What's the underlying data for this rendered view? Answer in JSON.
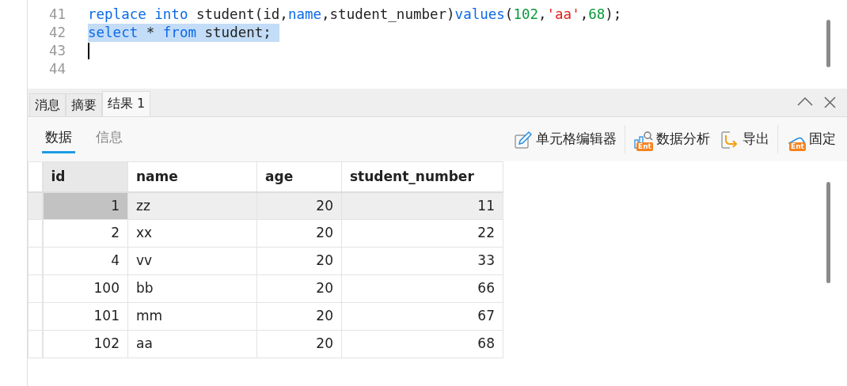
{
  "editor": {
    "lines": [
      {
        "number": "41",
        "selected": false,
        "cursor": false,
        "tokens": [
          {
            "kind": "keyword",
            "text": "replace into"
          },
          {
            "kind": "plain",
            "text": " student(id,"
          },
          {
            "kind": "keyword",
            "text": "name"
          },
          {
            "kind": "plain",
            "text": ",student_number)"
          },
          {
            "kind": "keyword",
            "text": "values"
          },
          {
            "kind": "plain",
            "text": "("
          },
          {
            "kind": "number",
            "text": "102"
          },
          {
            "kind": "plain",
            "text": ","
          },
          {
            "kind": "string",
            "text": "'aa'"
          },
          {
            "kind": "plain",
            "text": ","
          },
          {
            "kind": "number",
            "text": "68"
          },
          {
            "kind": "plain",
            "text": ");"
          }
        ]
      },
      {
        "number": "42",
        "selected": true,
        "cursor": false,
        "tokens": [
          {
            "kind": "keyword",
            "text": "select"
          },
          {
            "kind": "plain",
            "text": " * "
          },
          {
            "kind": "keyword",
            "text": "from"
          },
          {
            "kind": "plain",
            "text": " student; "
          }
        ]
      },
      {
        "number": "43",
        "selected": false,
        "cursor": true
      },
      {
        "number": "44",
        "selected": false,
        "cursor": false
      }
    ]
  },
  "result_tabs": [
    {
      "label": "消息",
      "selected": false
    },
    {
      "label": "摘要",
      "selected": false
    },
    {
      "label": "结果 1",
      "selected": true
    }
  ],
  "view_tabs": [
    {
      "label": "数据",
      "selected": true
    },
    {
      "label": "信息",
      "selected": false
    }
  ],
  "toolbar": [
    {
      "kind": "edit",
      "label": "单元格编辑器"
    },
    {
      "kind": "analysis",
      "label": "数据分析",
      "badge": "Ent"
    },
    {
      "kind": "export",
      "label": "导出"
    },
    {
      "kind": "pin",
      "label": "固定",
      "badge": "Ent"
    }
  ],
  "table": {
    "columns": [
      {
        "label": "id"
      },
      {
        "label": "name"
      },
      {
        "label": "age"
      },
      {
        "label": "student_number"
      }
    ],
    "rows": [
      {
        "selected": true,
        "cells": [
          "1",
          "zz",
          "20",
          "11"
        ]
      },
      {
        "selected": false,
        "cells": [
          "2",
          "xx",
          "20",
          "22"
        ]
      },
      {
        "selected": false,
        "cells": [
          "4",
          "vv",
          "20",
          "33"
        ]
      },
      {
        "selected": false,
        "cells": [
          "100",
          "bb",
          "20",
          "66"
        ]
      },
      {
        "selected": false,
        "cells": [
          "101",
          "mm",
          "20",
          "67"
        ]
      },
      {
        "selected": false,
        "cells": [
          "102",
          "aa",
          "20",
          "68"
        ]
      }
    ]
  }
}
